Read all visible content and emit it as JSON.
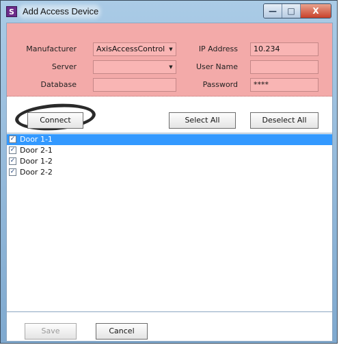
{
  "window": {
    "title": "Add Access Device",
    "app_icon_glyph": "S",
    "minimize_glyph": "—",
    "maximize_glyph": "□",
    "close_glyph": "X"
  },
  "form": {
    "manufacturer_label": "Manufacturer",
    "manufacturer_value": "AxisAccessControl",
    "server_label": "Server",
    "server_value": "",
    "database_label": "Database",
    "database_value": "",
    "ip_label": "IP Address",
    "ip_value": "10.234",
    "username_label": "User Name",
    "username_value": "",
    "password_label": "Password",
    "password_value": "****"
  },
  "buttons": {
    "connect": "Connect",
    "select_all": "Select All",
    "deselect_all": "Deselect All",
    "save": "Save",
    "cancel": "Cancel"
  },
  "doors": [
    {
      "label": "Door 1-1",
      "checked": true,
      "selected": true
    },
    {
      "label": "Door 2-1",
      "checked": true,
      "selected": false
    },
    {
      "label": "Door 1-2",
      "checked": true,
      "selected": false
    },
    {
      "label": "Door 2-2",
      "checked": true,
      "selected": false
    }
  ],
  "colors": {
    "panel_bg": "#f3aaa9",
    "selection": "#3399ff"
  },
  "icons": {
    "dropdown": "chevron-down-icon",
    "check": "checkmark-icon"
  }
}
